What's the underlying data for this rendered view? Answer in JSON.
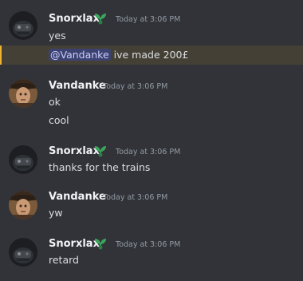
{
  "messages": [
    {
      "author": "Snorxlax",
      "timestamp": "Today at 3:06 PM",
      "avatar": "snorxlax-avatar",
      "badge": "seedling-badge",
      "lines": [
        "yes"
      ],
      "mention_line": {
        "mention": "@Vandanke",
        "text": " ive made 200£"
      }
    },
    {
      "author": "Vandanke",
      "timestamp": "Today at 3:06 PM",
      "avatar": "vandanke-avatar",
      "lines": [
        "ok",
        "cool"
      ]
    },
    {
      "author": "Snorxlax",
      "timestamp": "Today at 3:06 PM",
      "avatar": "snorxlax-avatar",
      "badge": "seedling-badge",
      "lines": [
        "thanks for the trains"
      ]
    },
    {
      "author": "Vandanke",
      "timestamp": "Today at 3:06 PM",
      "avatar": "vandanke-avatar",
      "lines": [
        "yw"
      ]
    },
    {
      "author": "Snorxlax",
      "timestamp": "Today at 3:06 PM",
      "avatar": "snorxlax-avatar",
      "badge": "seedling-badge",
      "lines": [
        "retard"
      ]
    }
  ],
  "colors": {
    "background": "#313338",
    "mention_highlight": "#444036",
    "mention_bar": "#f0b232",
    "mention_pill": "#3c4270",
    "badge_green": "#3ba55c"
  }
}
